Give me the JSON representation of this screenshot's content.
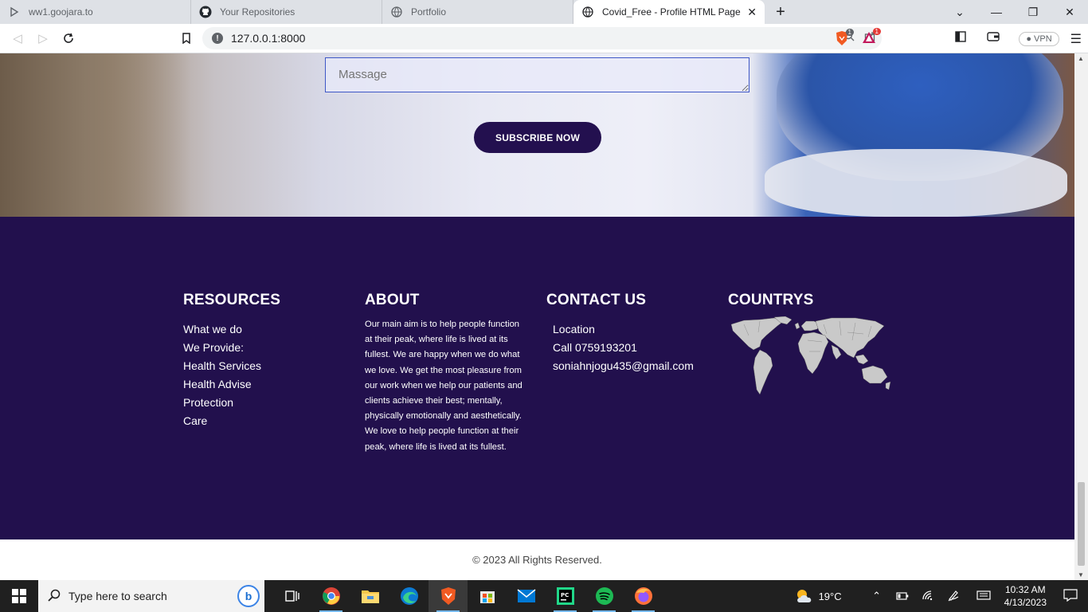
{
  "browser": {
    "tabs": [
      {
        "title": "ww1.goojara.to",
        "icon": "play-icon"
      },
      {
        "title": "Your Repositories",
        "icon": "github-icon"
      },
      {
        "title": "Portfolio",
        "icon": "globe-icon"
      },
      {
        "title": "Covid_Free - Profile HTML Page",
        "icon": "globe-icon",
        "active": true
      }
    ],
    "url": "127.0.0.1:8000",
    "vpn_label": "VPN",
    "shield_badge": "1",
    "rewards_badge": "1"
  },
  "page": {
    "form": {
      "message_placeholder": "Massage",
      "subscribe_label": "SUBSCRIBE NOW"
    },
    "footer": {
      "resources": {
        "heading": "RESOURCES",
        "items": [
          "What we do",
          "We Provide:",
          "Health Services",
          "Health Advise",
          "Protection",
          "Care"
        ]
      },
      "about": {
        "heading": "ABOUT",
        "text": "Our main aim is to help people function at their peak, where life is lived at its fullest. We are happy when we do what we love. We get the most pleasure from our work when we help our patients and clients achieve their best; mentally, physically emotionally and aesthetically. We love to help people function at their peak, where life is lived at its fullest."
      },
      "contact": {
        "heading": "CONTACT US",
        "items": [
          "Location",
          "Call 0759193201",
          "soniahnjogu435@gmail.com"
        ]
      },
      "countries": {
        "heading": "COUNTRYS"
      },
      "copyright": "© 2023 All Rights Reserved."
    },
    "colors": {
      "footer_bg": "#22104d",
      "button_bg": "#23104f"
    }
  },
  "taskbar": {
    "search_placeholder": "Type here to search",
    "weather_temp": "19°C",
    "time": "10:32 AM",
    "date": "4/13/2023",
    "apps": [
      "task-view-icon",
      "chrome-icon",
      "file-explorer-icon",
      "edge-icon",
      "brave-icon",
      "store-icon",
      "mail-icon",
      "pycharm-icon",
      "spotify-icon",
      "firefox-icon"
    ]
  }
}
